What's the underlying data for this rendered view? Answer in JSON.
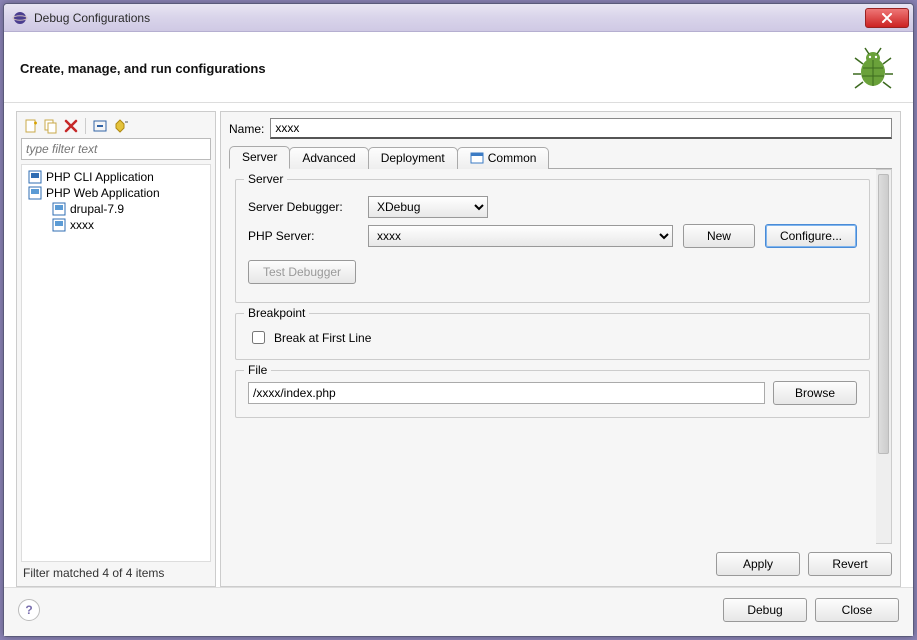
{
  "window": {
    "title": "Debug Configurations"
  },
  "header": {
    "title": "Create, manage, and run configurations"
  },
  "left": {
    "filter_placeholder": "type filter text",
    "tree": {
      "php_cli": "PHP CLI Application",
      "php_web": "PHP Web Application",
      "items": [
        {
          "label": "drupal-7.9"
        },
        {
          "label": "xxxx"
        }
      ]
    },
    "status": "Filter matched 4 of 4 items"
  },
  "right": {
    "name_label": "Name:",
    "name_value": "xxxx",
    "tabs": {
      "server": "Server",
      "advanced": "Advanced",
      "deployment": "Deployment",
      "common": "Common"
    },
    "server_group": {
      "title": "Server",
      "debugger_label": "Server Debugger:",
      "debugger_value": "XDebug",
      "php_server_label": "PHP Server:",
      "php_server_value": "xxxx",
      "new_btn": "New",
      "configure_btn": "Configure...",
      "test_btn": "Test Debugger"
    },
    "breakpoint_group": {
      "title": "Breakpoint",
      "break_first": "Break at First Line"
    },
    "file_group": {
      "title": "File",
      "value": "/xxxx/index.php",
      "browse_btn": "Browse"
    },
    "apply_btn": "Apply",
    "revert_btn": "Revert"
  },
  "footer": {
    "debug_btn": "Debug",
    "close_btn": "Close"
  }
}
